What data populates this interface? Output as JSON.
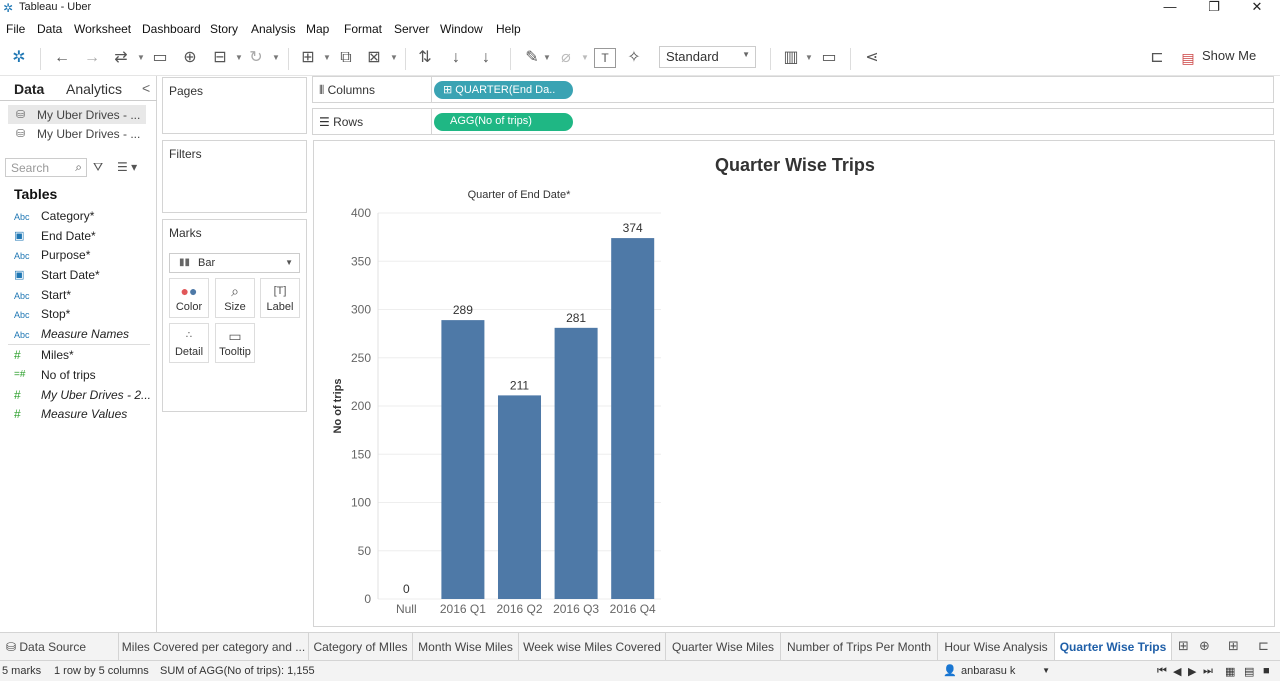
{
  "window": {
    "title": "Tableau - Uber",
    "minimize": "—",
    "restore": "❐",
    "close": "✕"
  },
  "menu": [
    "File",
    "Data",
    "Worksheet",
    "Dashboard",
    "Story",
    "Analysis",
    "Map",
    "Format",
    "Server",
    "Window",
    "Help"
  ],
  "toolbar": {
    "fit": "Standard",
    "show_me": "Show Me"
  },
  "data_pane": {
    "tab_data": "Data",
    "tab_analytics": "Analytics",
    "collapse": "<",
    "sources": [
      "My Uber Drives - ...",
      "My Uber Drives - ..."
    ],
    "search_placeholder": "Search",
    "tables_heading": "Tables",
    "dimensions": [
      {
        "type": "Abc",
        "name": "Category*"
      },
      {
        "type": "date",
        "name": "End Date*"
      },
      {
        "type": "Abc",
        "name": "Purpose*"
      },
      {
        "type": "date",
        "name": "Start Date*"
      },
      {
        "type": "Abc",
        "name": "Start*"
      },
      {
        "type": "Abc",
        "name": "Stop*"
      },
      {
        "type": "Abc",
        "name": "Measure Names"
      }
    ],
    "measures": [
      {
        "type": "#",
        "name": "Miles*"
      },
      {
        "type": "=#",
        "name": "No of trips"
      },
      {
        "type": "#",
        "name": "My Uber Drives - 2..."
      },
      {
        "type": "#",
        "name": "Measure Values"
      }
    ]
  },
  "cards": {
    "pages": "Pages",
    "filters": "Filters",
    "marks": "Marks",
    "mark_type": "Bar",
    "mark_buttons": [
      "Color",
      "Size",
      "Label",
      "Detail",
      "Tooltip"
    ]
  },
  "shelves": {
    "columns_label": "Columns",
    "columns_pill": "QUARTER(End Da..",
    "rows_label": "Rows",
    "rows_pill": "AGG(No of trips)"
  },
  "viz": {
    "title": "Quarter Wise Trips",
    "subtitle": "Quarter of End Date*"
  },
  "chart_data": {
    "type": "bar",
    "title": "Quarter Wise Trips",
    "xlabel": "Quarter of End Date*",
    "ylabel": "No of trips",
    "categories": [
      "Null",
      "2016 Q1",
      "2016 Q2",
      "2016 Q3",
      "2016 Q4"
    ],
    "values": [
      0,
      289,
      211,
      281,
      374
    ],
    "ylim": [
      0,
      400
    ],
    "yticks": [
      0,
      50,
      100,
      150,
      200,
      250,
      300,
      350,
      400
    ],
    "bar_color": "#4e79a7",
    "grid": true
  },
  "sheet_tabs": {
    "data_source": "Data Source",
    "tabs": [
      "Miles Covered per category and ...",
      "Category of MIles",
      "Month Wise Miles",
      "Week wise Miles Covered",
      "Quarter Wise Miles",
      "Number of Trips Per Month",
      "Hour Wise Analysis",
      "Quarter Wise Trips"
    ],
    "active": "Quarter Wise Trips"
  },
  "status": {
    "marks": "5 marks",
    "shape": "1 row by 5 columns",
    "sum": "SUM of AGG(No of trips): 1,155",
    "user": "anbarasu k"
  }
}
